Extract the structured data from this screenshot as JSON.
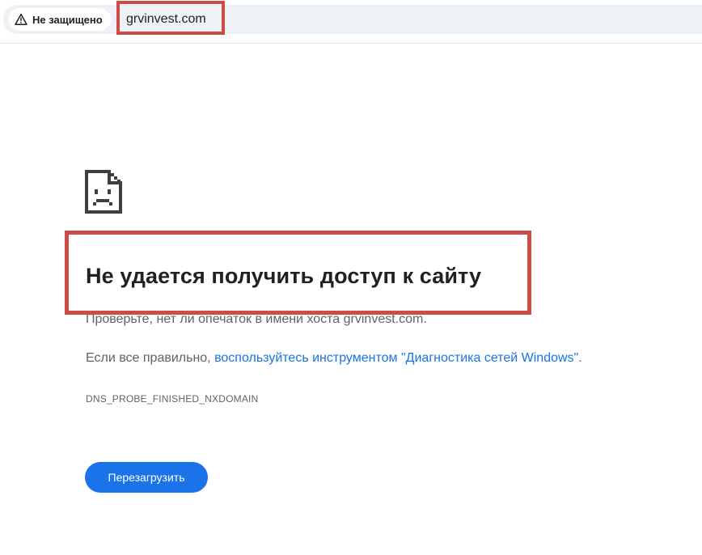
{
  "address_bar": {
    "security_label": "Не защищено",
    "security_icon": "warning-triangle-icon",
    "url": "grvinvest.com"
  },
  "error": {
    "icon": "sad-page-icon",
    "title": "Не удается получить доступ к сайту",
    "check_text": "Проверьте, нет ли опечаток в имени хоста grvinvest.com.",
    "diag_prefix": "Если все правильно, ",
    "diag_link": "воспользуйтесь инструментом \"Диагностика сетей Windows\"",
    "diag_suffix": ".",
    "code": "DNS_PROBE_FINISHED_NXDOMAIN",
    "reload_label": "Перезагрузить"
  },
  "colors": {
    "highlight": "#cf4b45",
    "link": "#1a73e8",
    "button": "#1a73e8"
  }
}
